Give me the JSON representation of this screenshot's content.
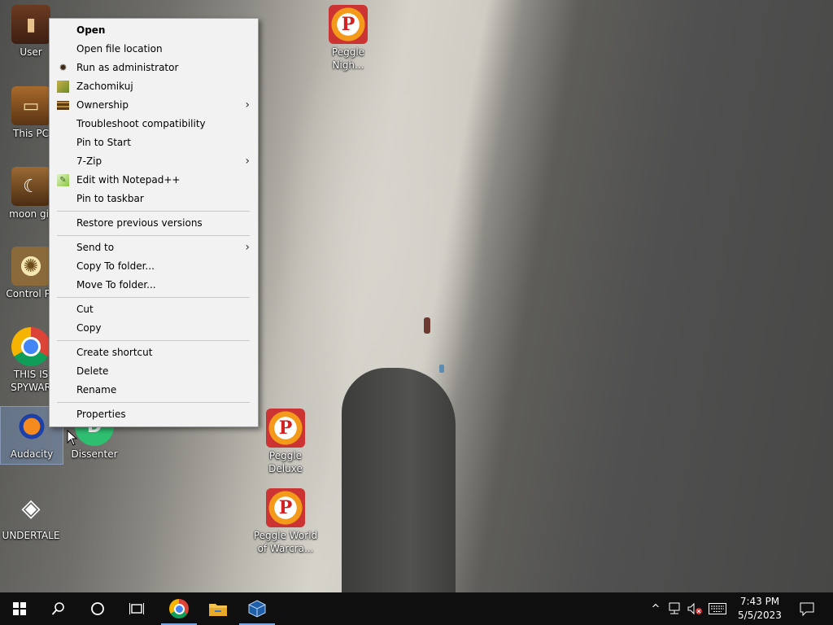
{
  "desktop_icons": [
    {
      "label": "User",
      "icon": "user-folder-icon"
    },
    {
      "label": "This PC",
      "icon": "computer-icon"
    },
    {
      "label": "moon gir",
      "icon": "moon-girl-icon"
    },
    {
      "label": "Control Pa",
      "icon": "control-panel-icon"
    },
    {
      "label": "THIS IS\nSPYWAR",
      "icon": "chrome-icon"
    },
    {
      "label": "Audacity",
      "icon": "audacity-icon"
    },
    {
      "label": "Dissenter",
      "icon": "dissenter-icon"
    },
    {
      "label": "UNDERTALE",
      "icon": "unity-icon"
    },
    {
      "label": "Peggle\nNigh...",
      "icon": "peggle-nights-icon"
    },
    {
      "label": "Peggle\nDeluxe",
      "icon": "peggle-deluxe-icon"
    },
    {
      "label": "Peggle World\nof Warcra...",
      "icon": "peggle-wow-icon"
    }
  ],
  "context_menu": {
    "items": [
      {
        "label": "Open",
        "bold": true
      },
      {
        "label": "Open file location"
      },
      {
        "label": "Run as administrator",
        "icon": "admin-shield-icon"
      },
      {
        "label": "Zachomikuj",
        "icon": "zachomikuj-icon"
      },
      {
        "label": "Ownership",
        "icon": "ownership-icon",
        "submenu": true
      },
      {
        "label": "Troubleshoot compatibility"
      },
      {
        "label": "Pin to Start"
      },
      {
        "label": "7-Zip",
        "submenu": true
      },
      {
        "label": "Edit with Notepad++",
        "icon": "notepad-plus-plus-icon"
      },
      {
        "label": "Pin to taskbar"
      },
      {
        "separator": true
      },
      {
        "label": "Restore previous versions"
      },
      {
        "separator": true
      },
      {
        "label": "Send to",
        "submenu": true
      },
      {
        "label": "Copy To folder..."
      },
      {
        "label": "Move To folder..."
      },
      {
        "separator": true
      },
      {
        "label": "Cut"
      },
      {
        "label": "Copy"
      },
      {
        "separator": true
      },
      {
        "label": "Create shortcut"
      },
      {
        "label": "Delete"
      },
      {
        "label": "Rename"
      },
      {
        "separator": true
      },
      {
        "label": "Properties"
      }
    ],
    "submenu_arrow": "›"
  },
  "taskbar": {
    "clock_time": "7:43 PM",
    "clock_date": "5/5/2023",
    "tray_chevron": "^",
    "accent": "#7aa7e0"
  }
}
